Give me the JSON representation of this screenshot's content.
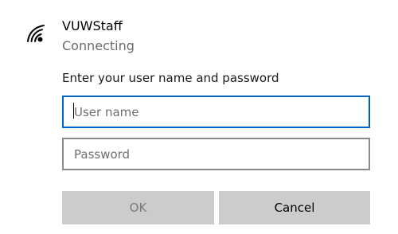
{
  "network": {
    "icon": "wifi-secured-icon",
    "name": "VUWStaff",
    "status": "Connecting"
  },
  "auth": {
    "prompt": "Enter your user name and password",
    "username": {
      "placeholder": "User name",
      "value": ""
    },
    "password": {
      "placeholder": "Password",
      "value": ""
    }
  },
  "buttons": {
    "ok_label": "OK",
    "cancel_label": "Cancel"
  },
  "colors": {
    "focus_border": "#0067c0",
    "field_border": "#8a8a8a",
    "button_bg": "#cccccc",
    "disabled_text": "#7a7a7a",
    "secondary_text": "#6b6b6b"
  }
}
